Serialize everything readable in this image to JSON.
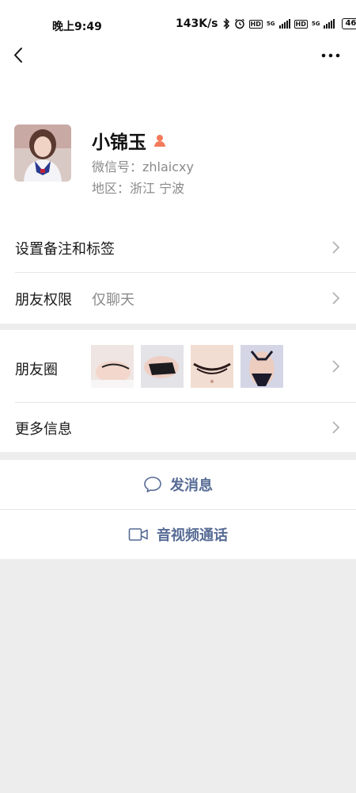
{
  "status": {
    "time": "晚上9:49",
    "speed": "143K/s",
    "battery": "46",
    "net1": "5G",
    "net2": "5G",
    "hd": "HD"
  },
  "profile": {
    "name": "小锦玉",
    "wechat_id": "微信号：zhlaicxy",
    "region": "地区：浙江  宁波"
  },
  "menu": {
    "remark_tags": "设置备注和标签",
    "permissions_label": "朋友权限",
    "permissions_value": "仅聊天",
    "moments_label": "朋友圈",
    "more_info": "更多信息"
  },
  "actions": {
    "send_message": "发消息",
    "video_call": "音视频通话"
  },
  "colors": {
    "link": "#576b95",
    "gender": "#f37a5a",
    "background": "#ededed"
  }
}
